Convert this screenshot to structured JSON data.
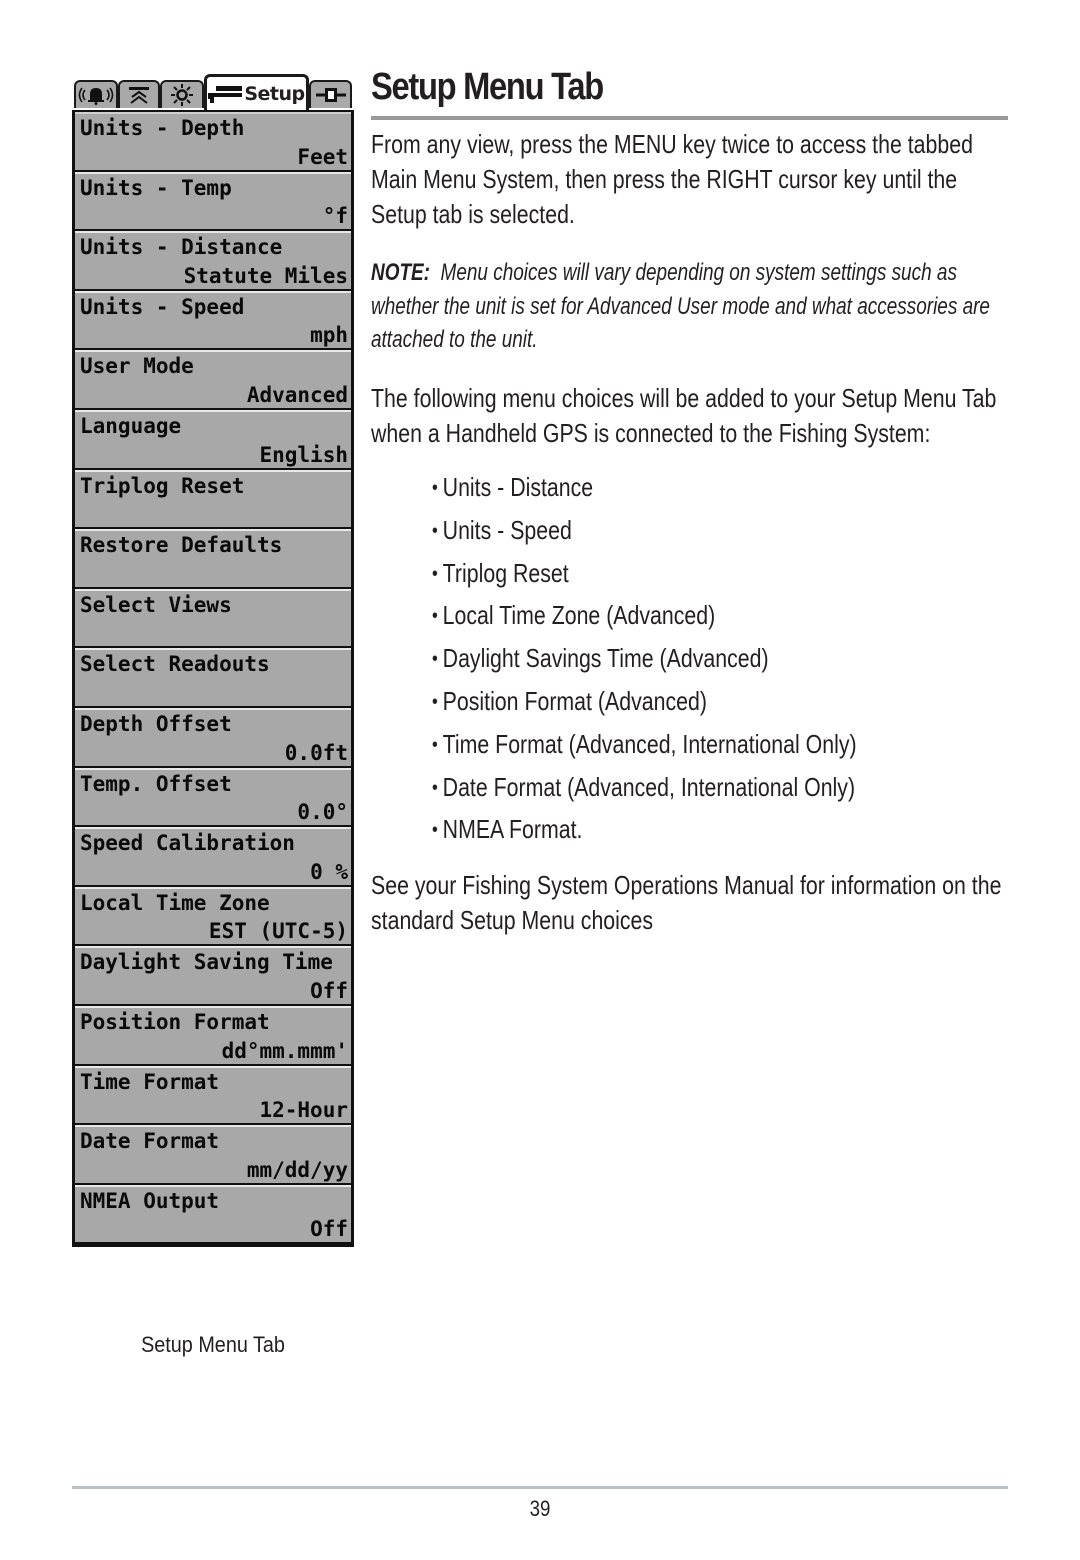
{
  "menu": {
    "tabs": [
      {
        "icon": "sonar-alarm-icon",
        "label": ""
      },
      {
        "icon": "sonar-beam-icon",
        "label": ""
      },
      {
        "icon": "display-brightness-icon",
        "label": ""
      },
      {
        "icon": "wrench-setup-icon",
        "label": "Setup",
        "active": true
      },
      {
        "icon": "accessory-connector-icon",
        "label": ""
      }
    ],
    "items": [
      {
        "label": "Units - Depth",
        "value": "Feet"
      },
      {
        "label": "Units - Temp",
        "value": "°f"
      },
      {
        "label": "Units - Distance",
        "value": "Statute Miles"
      },
      {
        "label": "Units - Speed",
        "value": "mph"
      },
      {
        "label": "User Mode",
        "value": "Advanced"
      },
      {
        "label": "Language",
        "value": "English"
      },
      {
        "label": "Triplog Reset",
        "value": ""
      },
      {
        "label": "Restore Defaults",
        "value": ""
      },
      {
        "label": "Select Views",
        "value": ""
      },
      {
        "label": "Select Readouts",
        "value": ""
      },
      {
        "label": "Depth Offset",
        "value": "0.0ft"
      },
      {
        "label": "Temp. Offset",
        "value": "0.0°"
      },
      {
        "label": "Speed Calibration",
        "value": "0 %"
      },
      {
        "label": "Local Time Zone",
        "value": "EST (UTC-5)"
      },
      {
        "label": "Daylight Saving Time",
        "value": "Off"
      },
      {
        "label": "Position Format",
        "value": "dd°mm.mmm'"
      },
      {
        "label": "Time Format",
        "value": "12-Hour"
      },
      {
        "label": "Date Format",
        "value": "mm/dd/yy"
      },
      {
        "label": "NMEA Output",
        "value": "Off"
      }
    ],
    "caption": "Setup Menu Tab"
  },
  "content": {
    "title": "Setup Menu Tab",
    "intro": "From any view, press the MENU key twice to access the tabbed Main Menu System, then press the RIGHT cursor key until the Setup tab is selected.",
    "note_label": "NOTE:",
    "note_text": "Menu choices will vary depending on system settings such as whether the unit is set for Advanced User mode and what accessories are attached to the unit.",
    "added_intro": "The following menu choices will be added to your Setup Menu Tab when a Handheld GPS is connected to the Fishing System:",
    "added_items": [
      "Units - Distance",
      "Units - Speed",
      "Triplog Reset",
      "Local Time Zone (Advanced)",
      "Daylight Savings Time (Advanced)",
      "Position Format (Advanced)",
      "Time Format (Advanced, International Only)",
      "Date Format (Advanced, International Only)",
      "NMEA Format."
    ],
    "see_also": "See your Fishing System Operations Manual for information on the standard Setup Menu choices"
  },
  "footer": {
    "page_number": "39"
  }
}
